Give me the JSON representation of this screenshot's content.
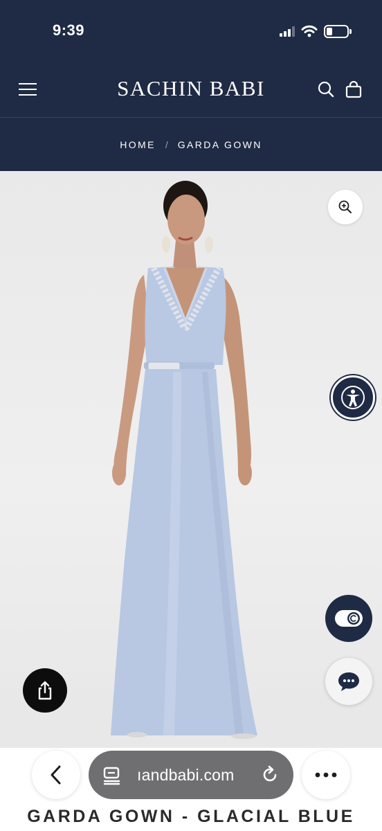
{
  "status_bar": {
    "time": "9:39",
    "icons": [
      "cellular-signal-icon",
      "wifi-icon",
      "battery-icon"
    ]
  },
  "header": {
    "brand": "SACHIN BABI",
    "menu_icon": "hamburger-menu-icon",
    "search_icon": "search-icon",
    "bag_icon": "shopping-bag-icon"
  },
  "breadcrumb": {
    "home": "HOME",
    "separator": "/",
    "current": "GARDA GOWN"
  },
  "product_image": {
    "zoom_icon": "zoom-in-icon",
    "accessibility_icon": "accessibility-icon",
    "share_icon": "share-icon",
    "cookie_consent_icon": "toggle-copyright-icon",
    "chat_icon": "chat-bubble-icon"
  },
  "browser": {
    "url": "ıandbabi.com",
    "back_icon": "chevron-left-icon",
    "reader_icon": "reader-mode-icon",
    "reload_icon": "reload-icon",
    "more_icon": "more-dots-icon"
  },
  "product": {
    "title": "GARDA GOWN - GLACIAL BLUE"
  },
  "colors": {
    "navy": "#1f2a44",
    "gown": "#b9c8e3",
    "background": "#ececec"
  }
}
